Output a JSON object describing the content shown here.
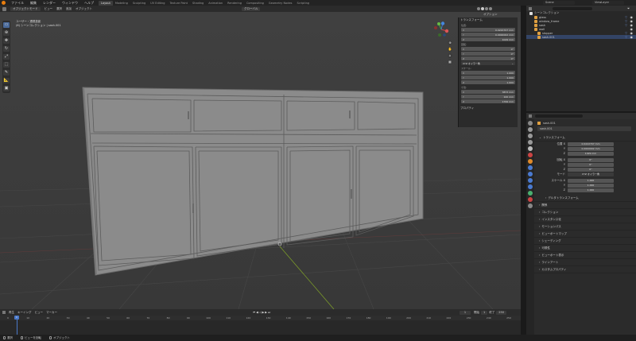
{
  "menubar": {
    "menus": [
      "ファイル",
      "編集",
      "レンダー",
      "ウィンドウ",
      "ヘルプ"
    ],
    "workspaces": [
      "Layout",
      "Modeling",
      "Sculpting",
      "UV Editing",
      "Texture Paint",
      "Shading",
      "Animation",
      "Rendering",
      "Compositing",
      "Geometry Nodes",
      "Scripting"
    ],
    "active_workspace": "Layout",
    "scene_name": "Scene",
    "view_layer": "ViewLayer"
  },
  "header3d": {
    "mode": "オブジェクトモード",
    "menus": [
      "ビュー",
      "選択",
      "追加",
      "オブジェクト"
    ],
    "transform": "グローバル",
    "options": "オプション"
  },
  "viewport": {
    "view_name": "ユーザー・透視投影",
    "collection_info": "(6) シーンコレクション | sash.001"
  },
  "npanel": {
    "transform_title": "トランスフォーム",
    "location_label": "位置:",
    "location": [
      {
        "axis": "X",
        "value": "0.0222707 mm"
      },
      {
        "axis": "Y",
        "value": "0.0000002 mm"
      },
      {
        "axis": "Z",
        "value": "1029 mm"
      }
    ],
    "rotation_label": "回転:",
    "rotation": [
      {
        "axis": "X",
        "value": "0°"
      },
      {
        "axis": "Y",
        "value": "0°"
      },
      {
        "axis": "Z",
        "value": "0°"
      }
    ],
    "rotation_mode": "XYZ オイラー角",
    "scale_label": "スケール:",
    "scale": [
      {
        "axis": "X",
        "value": "1.000"
      },
      {
        "axis": "Y",
        "value": "1.000"
      },
      {
        "axis": "Z",
        "value": "1.000"
      }
    ],
    "dimensions_label": "寸法:",
    "dimensions": [
      {
        "axis": "X",
        "value": "3873 mm"
      },
      {
        "axis": "Y",
        "value": "100 mm"
      },
      {
        "axis": "Z",
        "value": "1799 mm"
      }
    ],
    "properties_label": "プロパティ"
  },
  "outliner": {
    "root": "シーンコレクション",
    "items": [
      {
        "name": "glass",
        "color": "#e0a040"
      },
      {
        "name": "window_frame",
        "color": "#e0a040"
      },
      {
        "name": "sash",
        "color": "#e0a040"
      },
      {
        "name": "wall",
        "color": "#e0a040"
      },
      {
        "name": "stopper",
        "color": "#e0a040"
      },
      {
        "name": "sash.001",
        "color": "#e0a040"
      }
    ]
  },
  "properties": {
    "object_name": "sash.001",
    "data_name": "sash.001",
    "transform_title": "トランスフォーム",
    "location_label": "位置 X",
    "location": [
      "0.0222707 mm",
      "0.0000002 mm",
      "1029 mm"
    ],
    "rotation_label": "回転 X",
    "rotation": [
      "0°",
      "0°",
      "0°"
    ],
    "mode_label": "モード",
    "rotation_mode": "XYZ オイラー角",
    "scale_label": "スケール X",
    "scale": [
      "1.000",
      "1.000",
      "1.000"
    ],
    "axis_y": "Y",
    "axis_z": "Z",
    "delta_transform": "デルタトランスフォーム",
    "sections": [
      "関係",
      "コレクション",
      "インスタンス化",
      "モーションパス",
      "ビューポートマップ",
      "シェーディング",
      "可視性",
      "ビューポート表示",
      "ラインアート",
      "カスタムプロパティ"
    ]
  },
  "timeline": {
    "menus": [
      "再生",
      "キーイング",
      "ビュー",
      "マーカー"
    ],
    "current_frame": "1",
    "start_label": "開始",
    "start": "1",
    "end_label": "終了",
    "end": "250",
    "ticks": [
      "0",
      "10",
      "20",
      "30",
      "40",
      "50",
      "60",
      "70",
      "80",
      "90",
      "100",
      "110",
      "120",
      "130",
      "140",
      "150",
      "160",
      "170",
      "180",
      "190",
      "200",
      "210",
      "220",
      "230",
      "240",
      "250"
    ]
  },
  "statusbar": {
    "items": [
      "選択",
      "ビューを回転",
      "オブジェクト"
    ]
  }
}
